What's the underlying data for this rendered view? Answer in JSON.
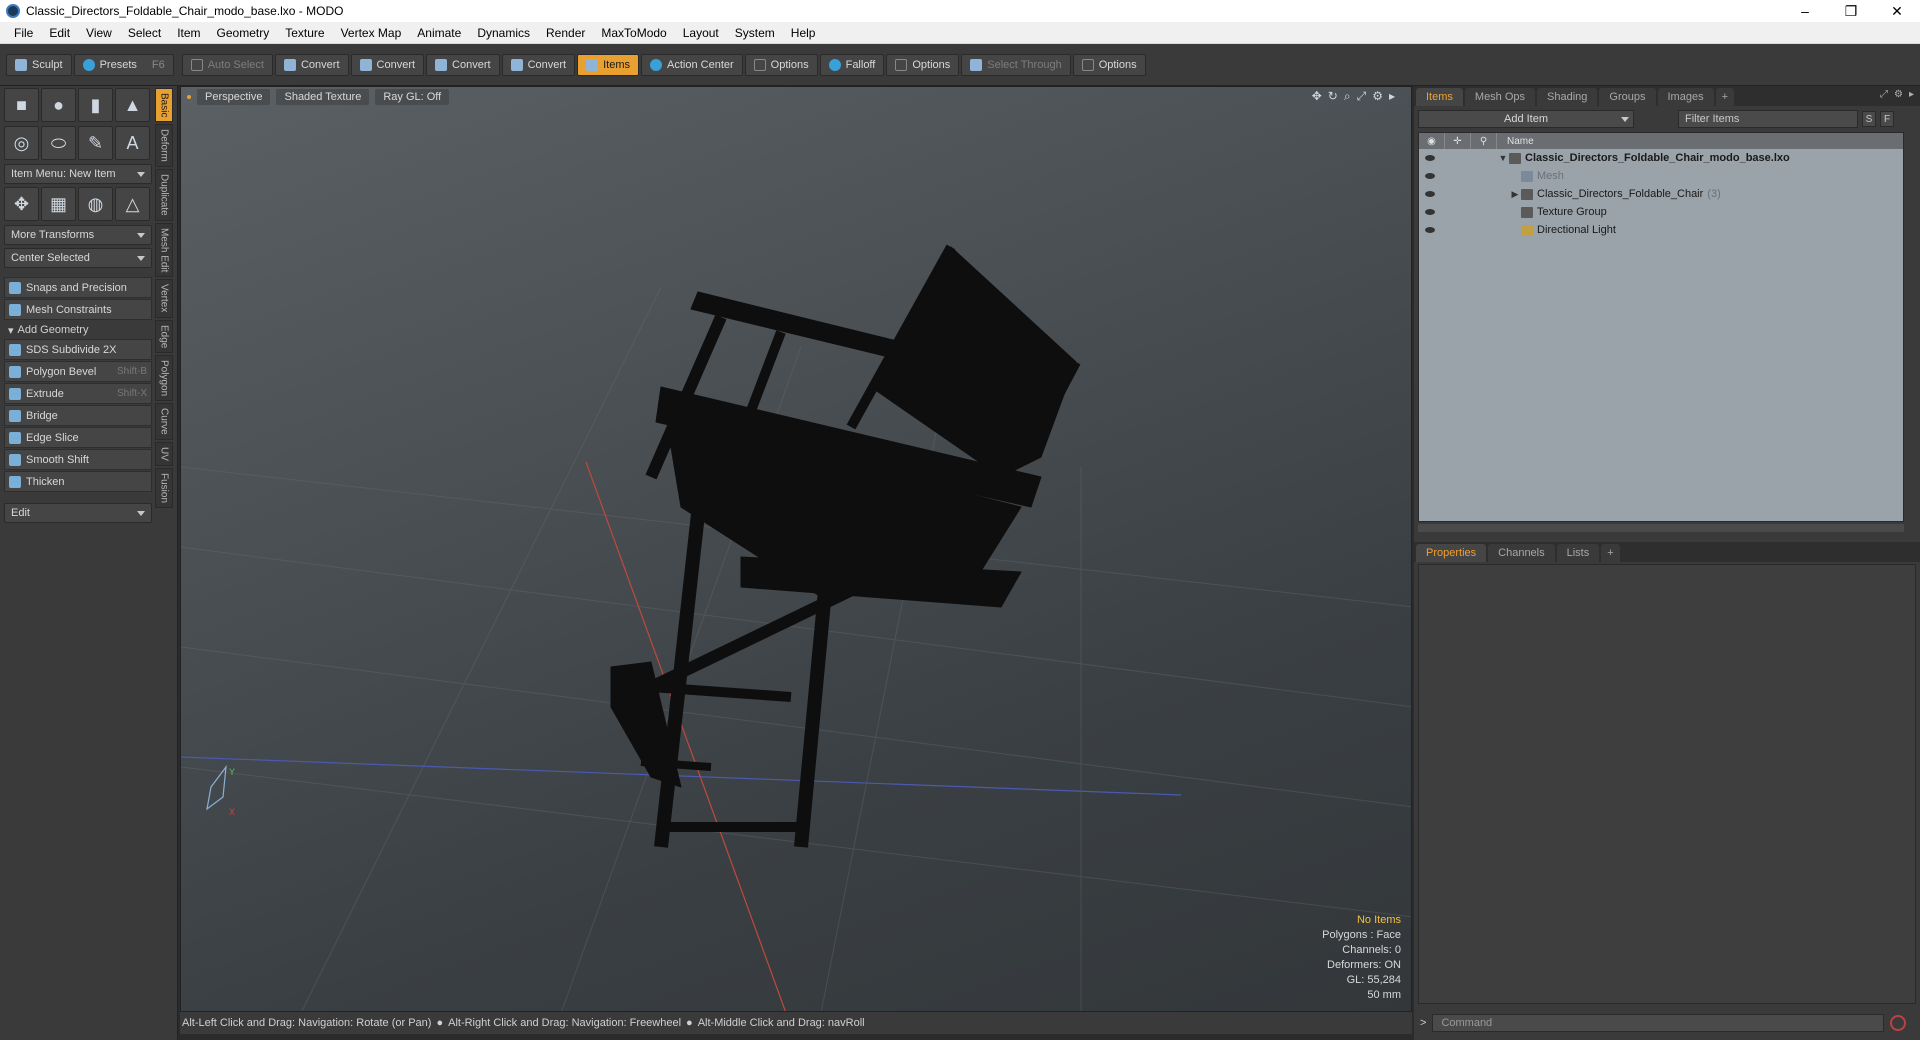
{
  "window": {
    "title": "Classic_Directors_Foldable_Chair_modo_base.lxo - MODO",
    "controls": [
      "–",
      "❐",
      "✕"
    ]
  },
  "menu": [
    "File",
    "Edit",
    "View",
    "Select",
    "Item",
    "Geometry",
    "Texture",
    "Vertex Map",
    "Animate",
    "Dynamics",
    "Render",
    "MaxToModo",
    "Layout",
    "System",
    "Help"
  ],
  "toolbar": {
    "sculpt": "Sculpt",
    "presets": "Presets",
    "presets_key": "F6",
    "auto_select": "Auto Select",
    "convert1": "Convert",
    "convert2": "Convert",
    "convert3": "Convert",
    "convert4": "Convert",
    "items": "Items",
    "action_center": "Action Center",
    "options1": "Options",
    "falloff": "Falloff",
    "options2": "Options",
    "select_through": "Select Through",
    "options3": "Options"
  },
  "left_panel": {
    "item_menu": "Item Menu: New Item",
    "more_transforms": "More Transforms",
    "center_selected": "Center Selected",
    "snaps": "Snaps and Precision",
    "mesh_constraints": "Mesh Constraints",
    "add_geometry": "Add Geometry",
    "tools": [
      {
        "label": "SDS Subdivide 2X",
        "shortcut": ""
      },
      {
        "label": "Polygon Bevel",
        "shortcut": "Shift-B"
      },
      {
        "label": "Extrude",
        "shortcut": "Shift-X"
      },
      {
        "label": "Bridge",
        "shortcut": ""
      },
      {
        "label": "Edge Slice",
        "shortcut": ""
      },
      {
        "label": "Smooth Shift",
        "shortcut": ""
      },
      {
        "label": "Thicken",
        "shortcut": ""
      }
    ],
    "edit": "Edit",
    "vtabs": [
      "Basic",
      "Deform",
      "Duplicate",
      "Mesh Edit",
      "Vertex",
      "Edge",
      "Polygon",
      "Curve",
      "UV",
      "Fusion"
    ]
  },
  "viewport": {
    "view": "Perspective",
    "shading": "Shaded Texture",
    "raygl": "Ray GL: Off",
    "stats": {
      "selection": "No Items",
      "polygons": "Polygons : Face",
      "channels": "Channels: 0",
      "deformers": "Deformers: ON",
      "gl": "GL: 55,284",
      "scale": "50 mm"
    }
  },
  "status": {
    "hint1": "Alt-Left Click and Drag: Navigation: Rotate (or Pan)",
    "hint2": "Alt-Right Click and Drag: Navigation: Freewheel",
    "hint3": "Alt-Middle Click and Drag: navRoll"
  },
  "right_panel": {
    "tabs": [
      "Items",
      "Mesh Ops",
      "Shading",
      "Groups",
      "Images"
    ],
    "add_item": "Add Item",
    "filter_placeholder": "Filter Items",
    "s_btn": "S",
    "f_btn": "F",
    "name_col": "Name",
    "tree": [
      {
        "label": "Classic_Directors_Foldable_Chair_modo_base.lxo",
        "count": ""
      },
      {
        "label": "Mesh",
        "count": ""
      },
      {
        "label": "Classic_Directors_Foldable_Chair",
        "count": "(3)"
      },
      {
        "label": "Texture Group",
        "count": ""
      },
      {
        "label": "Directional Light",
        "count": ""
      }
    ],
    "prop_tabs": [
      "Properties",
      "Channels",
      "Lists"
    ],
    "command_placeholder": "Command"
  },
  "colors": {
    "accent": "#e8a030",
    "panel": "#3a3a3a",
    "tree_bg": "#9aa2aa"
  }
}
